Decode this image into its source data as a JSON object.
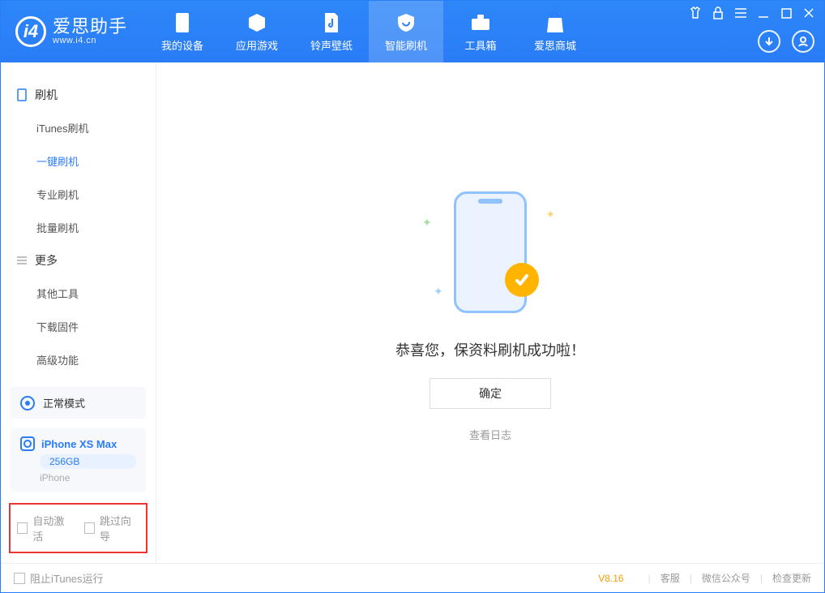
{
  "app": {
    "name_cn": "爱思助手",
    "domain": "www.i4.cn"
  },
  "nav": {
    "my_device": "我的设备",
    "apps_games": "应用游戏",
    "ringtones": "铃声壁纸",
    "flash": "智能刷机",
    "toolbox": "工具箱",
    "store": "爱思商城"
  },
  "sidebar": {
    "flash_header": "刷机",
    "items": {
      "itunes": "iTunes刷机",
      "oneclick": "一键刷机",
      "pro": "专业刷机",
      "batch": "批量刷机"
    },
    "more_header": "更多",
    "more": {
      "other_tools": "其他工具",
      "download_fw": "下载固件",
      "advanced": "高级功能"
    }
  },
  "mode": {
    "label": "正常模式"
  },
  "device": {
    "name": "iPhone XS Max",
    "capacity": "256GB",
    "sub": "iPhone"
  },
  "checks": {
    "auto_activate": "自动激活",
    "skip_guide": "跳过向导"
  },
  "main": {
    "success_msg": "恭喜您，保资料刷机成功啦！",
    "ok_btn": "确定",
    "view_log": "查看日志"
  },
  "footer": {
    "block_itunes": "阻止iTunes运行",
    "version": "V8.16",
    "support": "客服",
    "wechat": "微信公众号",
    "check_update": "检查更新"
  }
}
